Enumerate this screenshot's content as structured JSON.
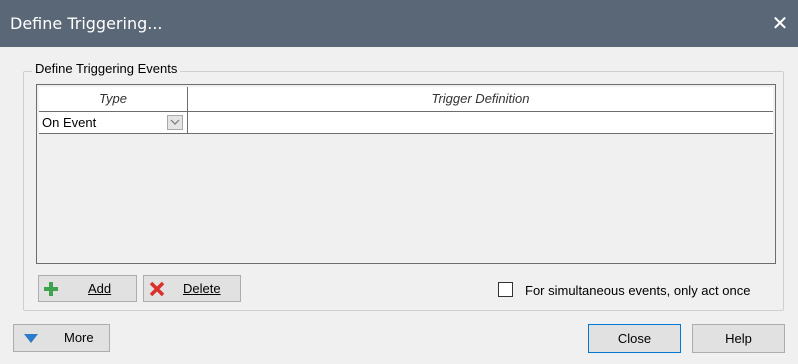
{
  "window": {
    "title": "Define Triggering..."
  },
  "group": {
    "label": "Define Triggering Events"
  },
  "grid": {
    "columns": [
      "Type",
      "Trigger Definition"
    ],
    "rows": [
      {
        "type": "On Event",
        "definition": ""
      }
    ]
  },
  "buttons": {
    "add": "Add",
    "delete": "Delete",
    "more": "More",
    "close": "Close",
    "help": "Help"
  },
  "checkbox": {
    "label": "For simultaneous events, only act once",
    "checked": false
  },
  "colors": {
    "titlebar": "#5a6776",
    "add_icon": "#3fa34d",
    "delete_icon": "#d9302c",
    "more_icon": "#2b7bc8"
  },
  "icons": {
    "add": "plus-icon",
    "delete": "x-icon",
    "more": "triangle-down-icon",
    "combo": "chevron-down-icon",
    "close": "close-icon"
  }
}
